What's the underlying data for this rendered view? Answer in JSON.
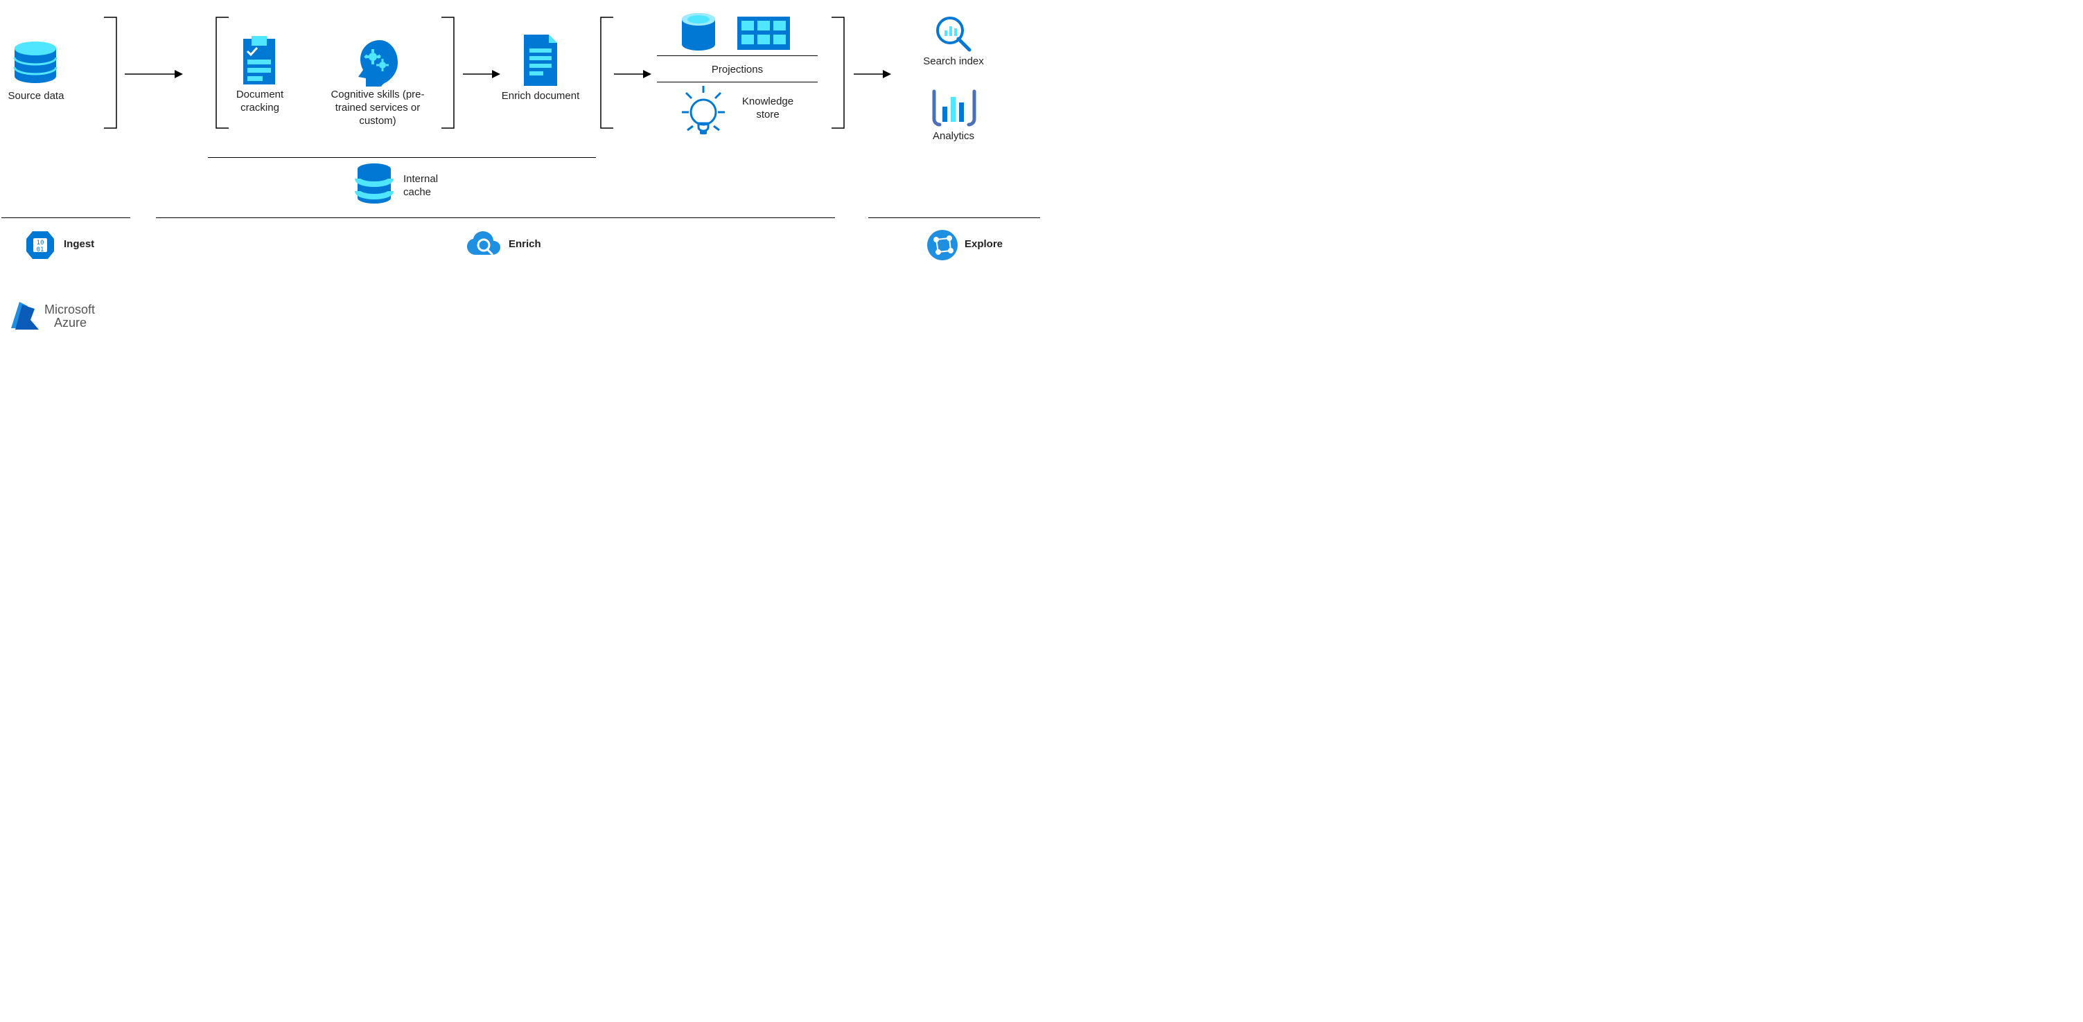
{
  "colors": {
    "azure_dark": "#0078D4",
    "azure_light": "#50E6FF",
    "azure_mid": "#2F7ED8",
    "text": "#222222"
  },
  "labels": {
    "source_data": "Source data",
    "doc_cracking": "Document\ncracking",
    "cog_skills": "Cognitive skills (pre-\ntrained services or\ncustom)",
    "enrich_doc": "Enrich document",
    "projections": "Projections",
    "knowledge_store": "Knowledge\nstore",
    "internal_cache": "Internal\ncache",
    "search_index": "Search index",
    "analytics": "Analytics"
  },
  "phases": {
    "ingest": "Ingest",
    "enrich": "Enrich",
    "explore": "Explore"
  },
  "branding": {
    "line1": "Microsoft",
    "line2": "Azure"
  }
}
